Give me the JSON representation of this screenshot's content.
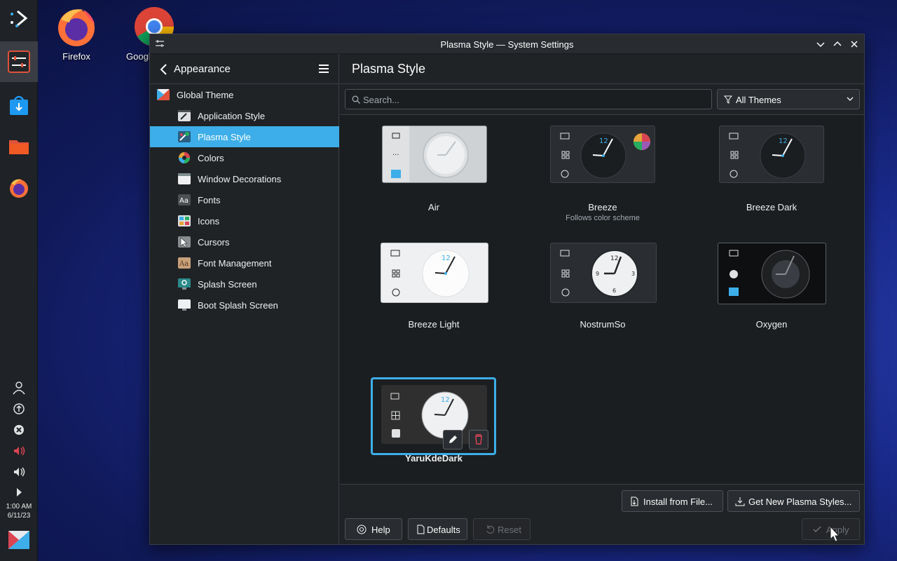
{
  "desktop": {
    "icons": [
      {
        "label": "Firefox",
        "icon": "firefox-icon"
      },
      {
        "label": "Google",
        "icon": "chrome-icon"
      }
    ]
  },
  "panel": {
    "clock_time": "1:00 AM",
    "clock_date": "6/11/23"
  },
  "window": {
    "title": "Plasma Style — System Settings"
  },
  "sidebar": {
    "heading": "Appearance",
    "items": [
      {
        "label": "Global Theme",
        "icon": "global-theme-icon",
        "color": "#e0523b"
      },
      {
        "label": "Application Style",
        "icon": "application-style-icon",
        "color": "#dfe1e3"
      },
      {
        "label": "Plasma Style",
        "icon": "plasma-style-icon",
        "color": "#3daee9"
      },
      {
        "label": "Colors",
        "icon": "colors-icon",
        "color": "#e6a43a"
      },
      {
        "label": "Window Decorations",
        "icon": "window-decorations-icon",
        "color": "#dfe1e3"
      },
      {
        "label": "Fonts",
        "icon": "fonts-icon",
        "color": "#4d4f52"
      },
      {
        "label": "Icons",
        "icon": "icons-icon",
        "color": "#3daee9"
      },
      {
        "label": "Cursors",
        "icon": "cursors-icon",
        "color": "#8a8d90"
      },
      {
        "label": "Font Management",
        "icon": "font-management-icon",
        "color": "#c8a07a"
      },
      {
        "label": "Splash Screen",
        "icon": "splash-screen-icon",
        "color": "#1d99f3"
      },
      {
        "label": "Boot Splash Screen",
        "icon": "boot-splash-icon",
        "color": "#eff0f1"
      }
    ]
  },
  "main": {
    "title": "Plasma Style",
    "search_placeholder": "Search...",
    "filter_label": "All Themes",
    "themes": [
      {
        "name": "Air",
        "subtitle": "",
        "style": "light",
        "bg": "#cfd2d5"
      },
      {
        "name": "Breeze",
        "subtitle": "Follows color scheme",
        "style": "dark",
        "bg": "#2a2e32"
      },
      {
        "name": "Breeze Dark",
        "subtitle": "",
        "style": "dark",
        "bg": "#2a2e32"
      },
      {
        "name": "Breeze Light",
        "subtitle": "",
        "style": "light",
        "bg": "#eff0f1"
      },
      {
        "name": "NostrumSo",
        "subtitle": "",
        "style": "dark",
        "bg": "#2a2e32"
      },
      {
        "name": "Oxygen",
        "subtitle": "",
        "style": "black",
        "bg": "#0e0f10"
      },
      {
        "name": "YaruKdeDark",
        "subtitle": "",
        "style": "dark",
        "bg": "#2f2f2f"
      }
    ],
    "current_theme": "YaruKdeDark",
    "install_label": "Install from File...",
    "get_new_label": "Get New Plasma Styles...",
    "help_label": "Help",
    "defaults_label": "Defaults",
    "reset_label": "Reset",
    "apply_label": "Apply"
  },
  "colors": {
    "accent": "#3daee9",
    "window_bg": "#202326",
    "view_bg": "#1b1e20",
    "delete": "#da4453"
  }
}
